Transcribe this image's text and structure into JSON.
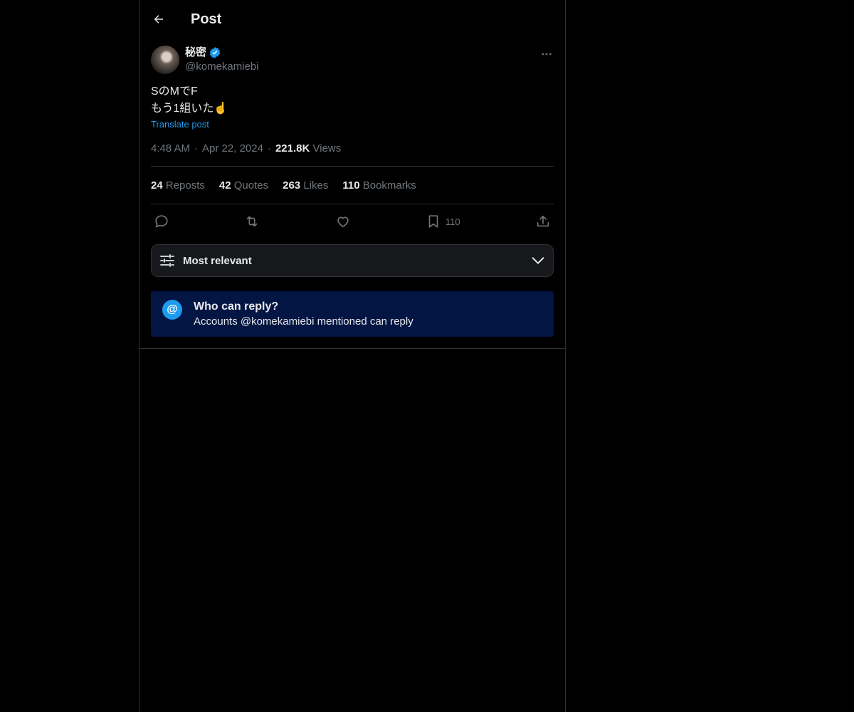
{
  "header": {
    "title": "Post"
  },
  "author": {
    "display_name": "秘密",
    "handle": "@komekamiebi"
  },
  "post": {
    "line1": "SのMでF",
    "line2": "もう1組いた☝️",
    "translate_label": "Translate post"
  },
  "meta": {
    "time": "4:48 AM",
    "date": "Apr 22, 2024",
    "views_count": "221.8K",
    "views_label": "Views",
    "separator": "·"
  },
  "stats": [
    {
      "num": "24",
      "label": "Reposts"
    },
    {
      "num": "42",
      "label": "Quotes"
    },
    {
      "num": "263",
      "label": "Likes"
    },
    {
      "num": "110",
      "label": "Bookmarks"
    }
  ],
  "actions": {
    "bookmark_count": "110"
  },
  "sort": {
    "label": "Most relevant"
  },
  "reply_restriction": {
    "badge": "@",
    "title": "Who can reply?",
    "subtitle": "Accounts @komekamiebi mentioned can reply"
  },
  "colors": {
    "background": "#000000",
    "accent": "#1d9bf0",
    "reply_box": "#031543",
    "muted": "#71767b"
  }
}
